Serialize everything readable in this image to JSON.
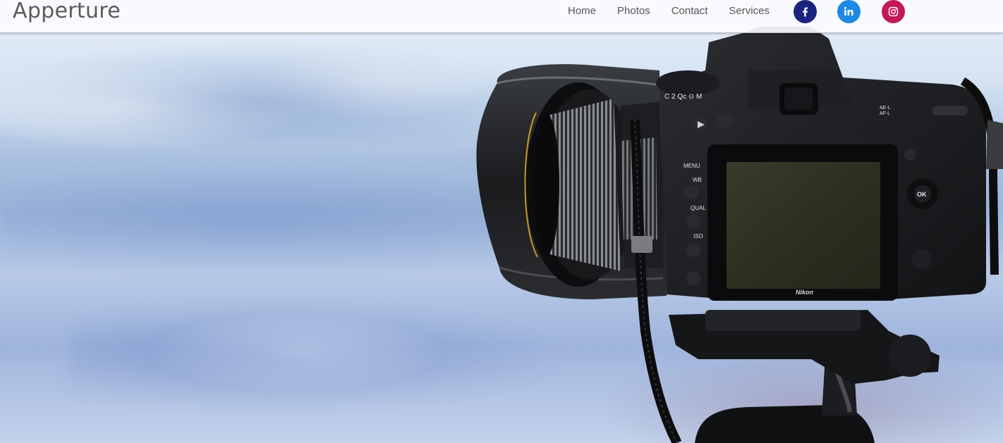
{
  "brand": "Apperture",
  "nav": {
    "items": [
      {
        "label": "Home"
      },
      {
        "label": "Photos"
      },
      {
        "label": "Contact"
      },
      {
        "label": "Services"
      }
    ]
  },
  "social": [
    {
      "icon": "facebook-icon",
      "color": "#1a237e"
    },
    {
      "icon": "linkedin-icon",
      "color": "#1e88e5"
    },
    {
      "icon": "instagram-icon",
      "color": "#c2185b"
    }
  ],
  "camera": {
    "brand_mark": "Nikon",
    "buttons": [
      "MENU",
      "WB",
      "QUAL",
      "ISO",
      "OK",
      "AE-L AF-L",
      "L"
    ]
  }
}
